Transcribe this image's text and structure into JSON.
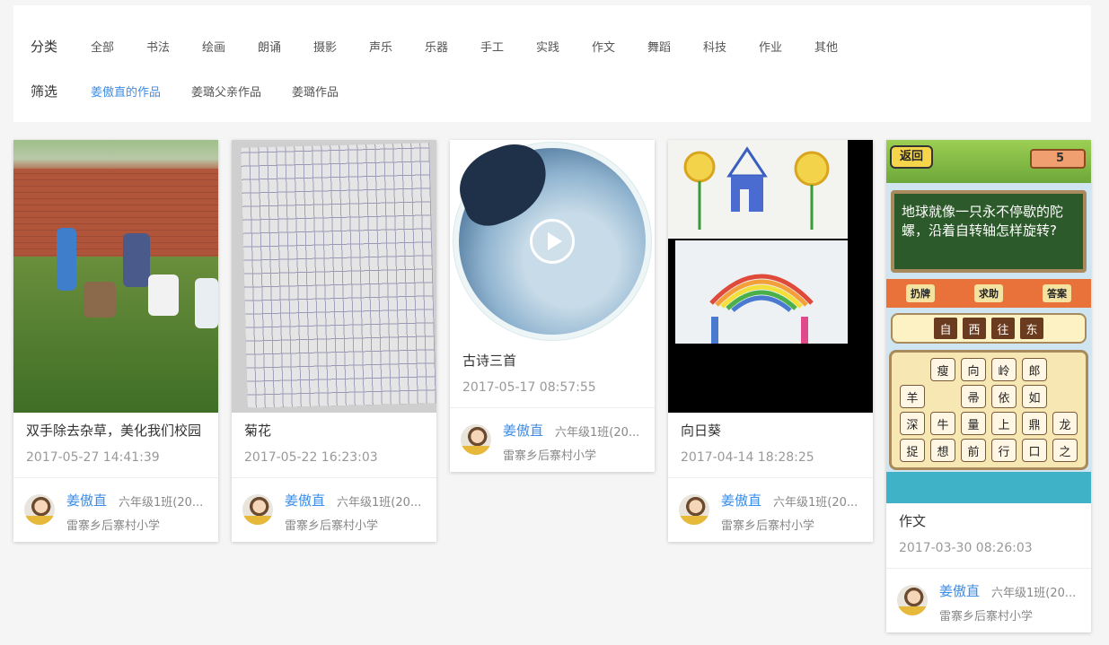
{
  "filters": {
    "category_label": "分类",
    "categories": [
      "全部",
      "书法",
      "绘画",
      "朗诵",
      "摄影",
      "声乐",
      "乐器",
      "手工",
      "实践",
      "作文",
      "舞蹈",
      "科技",
      "作业",
      "其他"
    ],
    "category_active": "全部",
    "screen_label": "筛选",
    "screens": [
      "姜傲直的作品",
      "姜璐父亲作品",
      "姜璐作品"
    ],
    "screen_active": "姜傲直的作品"
  },
  "cards": [
    {
      "title": "双手除去杂草，美化我们校园",
      "date": "2017-05-27 14:41:39",
      "thumb": "photo-students-weeding"
    },
    {
      "title": "菊花",
      "date": "2017-05-22 16:23:03",
      "thumb": "photo-handwritten-essay"
    },
    {
      "title": "古诗三首",
      "date": "2017-05-17 08:57:55",
      "thumb": "video-cover"
    },
    {
      "title": "向日葵",
      "date": "2017-04-14 18:28:25",
      "thumb": "photo-children-drawing"
    },
    {
      "title": "作文",
      "date": "2017-03-30 08:26:03",
      "thumb": "game-screenshot"
    }
  ],
  "author": {
    "name": "姜傲直",
    "class": "六年级1班(20...",
    "school": "雷寨乡后寨村小学"
  },
  "game": {
    "back": "返回",
    "coins": "5",
    "question": "地球就像一只永不停歇的陀螺，沿着自转轴怎样旋转?",
    "tools": [
      "扔牌",
      "求助",
      "答案"
    ],
    "answer": [
      "自",
      "西",
      "往",
      "东"
    ],
    "letters": [
      "",
      "瘦",
      "向",
      "岭",
      "郎",
      "",
      "羊",
      "",
      "帚",
      "依",
      "如",
      "",
      "深",
      "牛",
      "量",
      "上",
      "鼎",
      "龙",
      "捉",
      "想",
      "前",
      "行",
      "口",
      "之"
    ]
  },
  "colors": {
    "accent": "#3b8ee8",
    "muted": "#999999",
    "background": "#f5f5f5"
  }
}
